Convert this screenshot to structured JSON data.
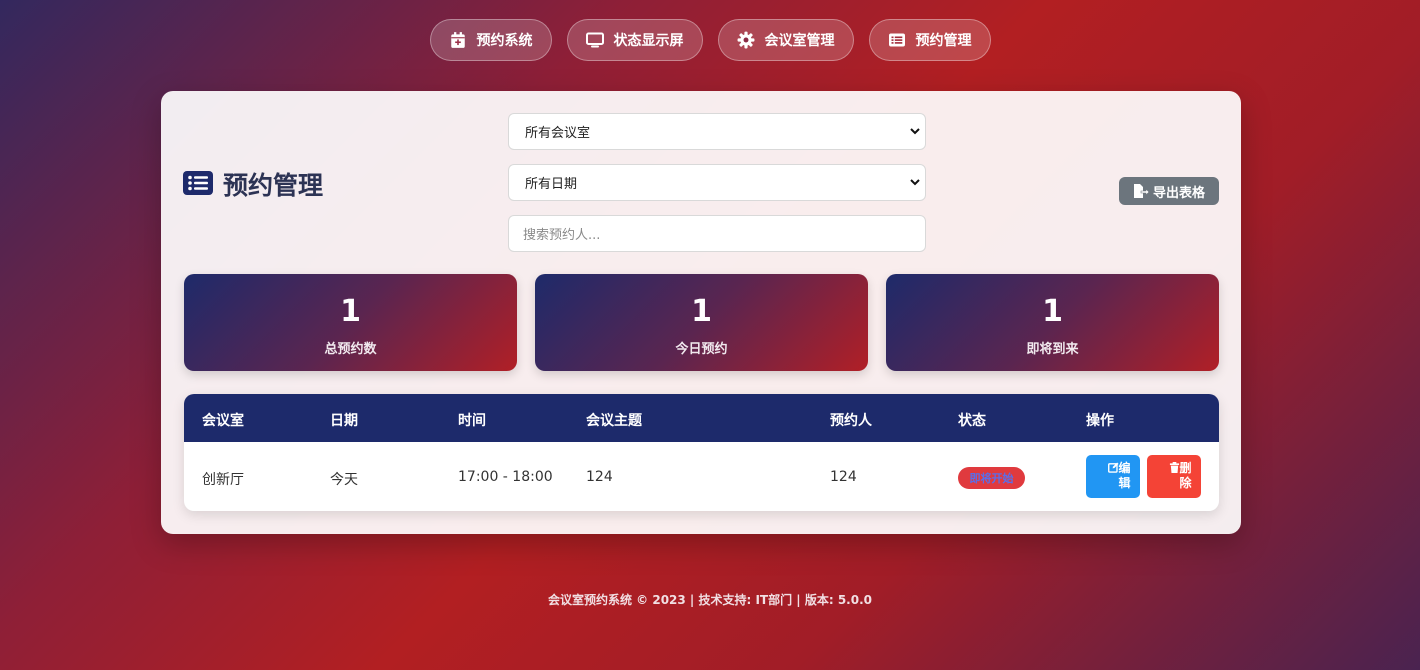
{
  "nav": {
    "items": [
      {
        "label": "预约系统",
        "icon": "calendar-plus-icon"
      },
      {
        "label": "状态显示屏",
        "icon": "monitor-icon"
      },
      {
        "label": "会议室管理",
        "icon": "gear-icon"
      },
      {
        "label": "预约管理",
        "icon": "list-alt-icon"
      }
    ]
  },
  "header": {
    "title": "预约管理",
    "title_icon": "list-icon"
  },
  "filters": {
    "room_select": "所有会议室",
    "date_select": "所有日期",
    "search_placeholder": "搜索预约人..."
  },
  "export": {
    "label": "导出表格",
    "icon": "file-export-icon"
  },
  "stats": [
    {
      "value": "1",
      "label": "总预约数"
    },
    {
      "value": "1",
      "label": "今日预约"
    },
    {
      "value": "1",
      "label": "即将到来"
    }
  ],
  "table": {
    "columns": [
      "会议室",
      "日期",
      "时间",
      "会议主题",
      "预约人",
      "状态",
      "操作"
    ],
    "rows": [
      {
        "room": "创新厅",
        "date": "今天",
        "time": "17:00 - 18:00",
        "subject": "124",
        "booker": "124",
        "status": "即将开始",
        "edit_label": "编\n辑",
        "delete_label": "删\n除"
      }
    ]
  },
  "footer": {
    "text": "会议室预约系统 © 2023 | 技术支持: IT部门 | 版本: 5.0.0"
  },
  "colors": {
    "header_navy": "#1d2a6b",
    "edit_blue": "#2196f3",
    "delete_red": "#f44336",
    "export_gray": "#6c757d",
    "status_red": "#e03a3e"
  }
}
